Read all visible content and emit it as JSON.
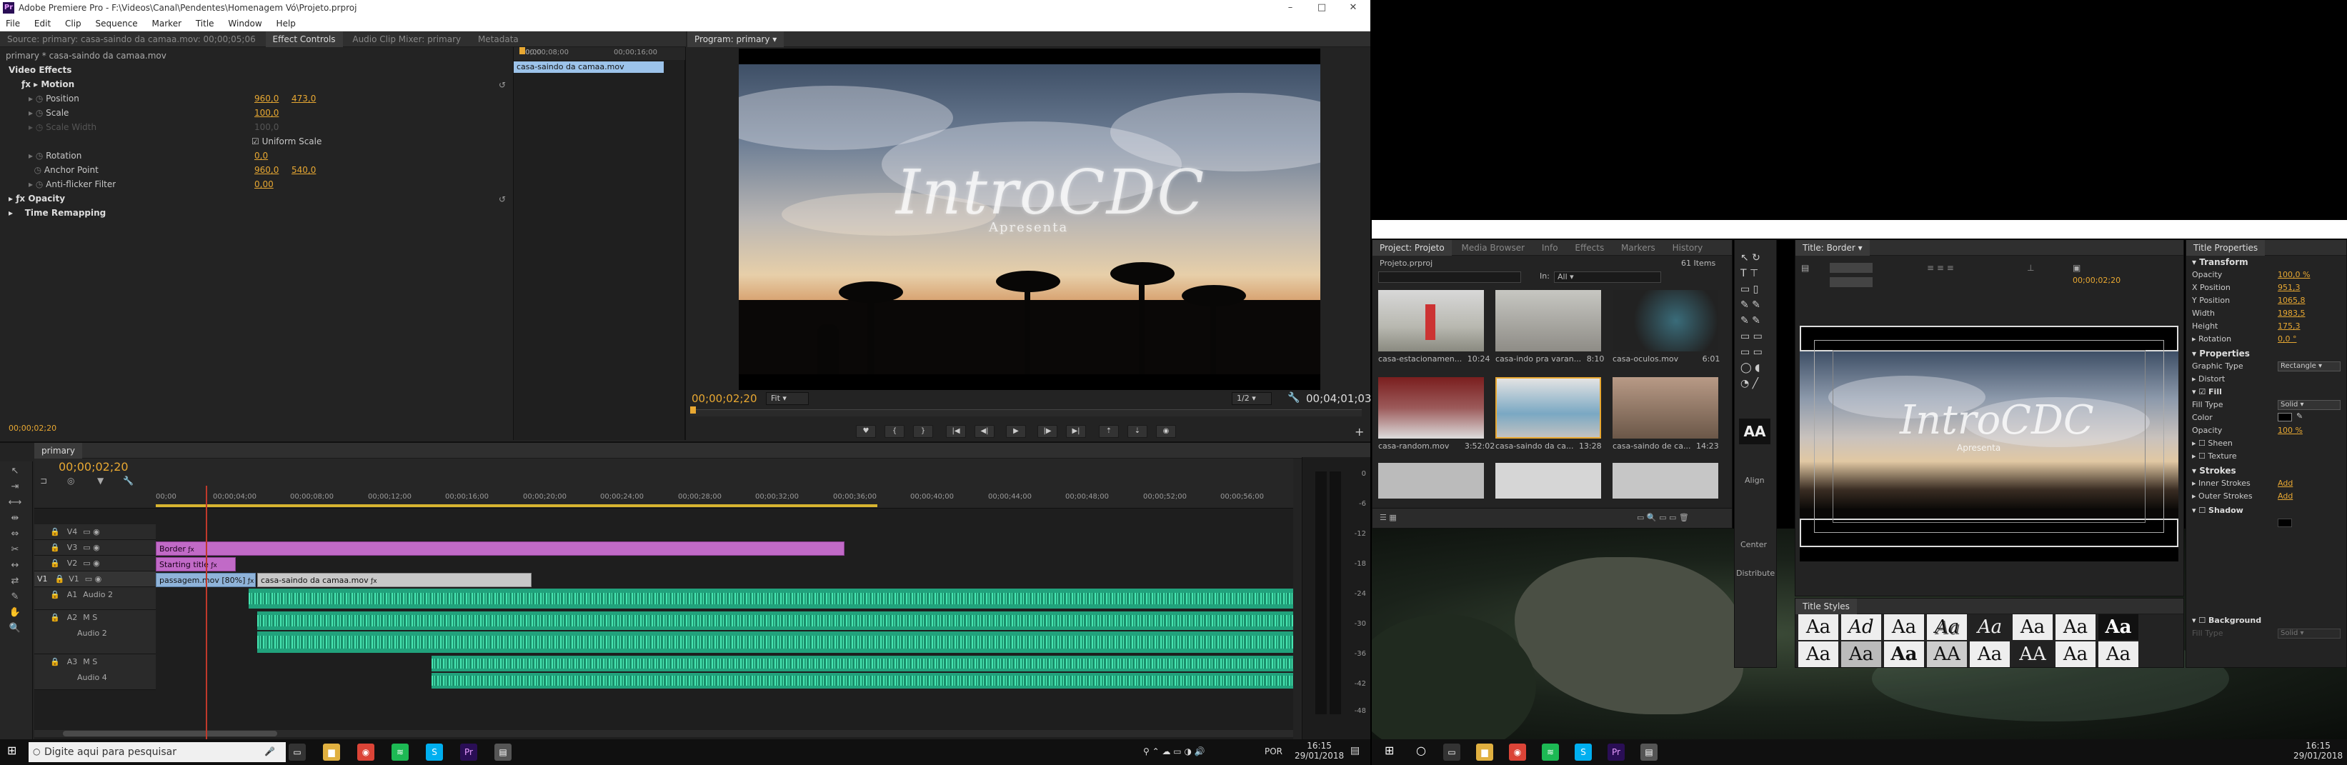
{
  "window": {
    "title": "Adobe Premiere Pro - F:\\Videos\\Canal\\Pendentes\\Homenagem Vó\\Projeto.prproj",
    "app_icon": "Pr"
  },
  "menu": [
    "File",
    "Edit",
    "Clip",
    "Sequence",
    "Marker",
    "Title",
    "Window",
    "Help"
  ],
  "source_panel": {
    "tabs": [
      "Source: primary: casa-saindo da camaa.mov: 00;00;05;06",
      "Effect Controls",
      "Audio Clip Mixer: primary",
      "Metadata"
    ],
    "clip_path": "primary * casa-saindo da camaa.mov",
    "mini_timeline": {
      "t0": "00;00",
      "t1": "00;00;08;00",
      "t2": "00;00;16;00",
      "clip_name": "casa-saindo da camaa.mov"
    },
    "video_effects_label": "Video Effects",
    "motion": "Motion",
    "params": [
      {
        "name": "Position",
        "v1": "960,0",
        "v2": "473,0"
      },
      {
        "name": "Scale",
        "v1": "100,0",
        "v2": ""
      },
      {
        "name": "Scale Width",
        "v1": "100,0",
        "v2": ""
      },
      {
        "name": "Rotation",
        "v1": "0,0",
        "v2": ""
      },
      {
        "name": "Anchor Point",
        "v1": "960,0",
        "v2": "540,0"
      },
      {
        "name": "Anti-flicker Filter",
        "v1": "0,00",
        "v2": ""
      }
    ],
    "uniform_scale": "Uniform Scale",
    "opacity": "Opacity",
    "time_remapping": "Time Remapping",
    "timecode": "00;00;02;20"
  },
  "program_panel": {
    "tab": "Program: primary",
    "current_tc": "00;00;02;20",
    "fit": "Fit",
    "resolution": "1/2",
    "duration_tc": "00;04;01;03",
    "overlay_title": "IntroCDC",
    "overlay_sub": "Apresenta"
  },
  "sequence": {
    "tab": "primary",
    "timecode": "00;00;02;20",
    "ruler": [
      "00;00",
      "00;00;04;00",
      "00;00;08;00",
      "00;00;12;00",
      "00;00;16;00",
      "00;00;20;00",
      "00;00;24;00",
      "00;00;28;00",
      "00;00;32;00",
      "00;00;36;00",
      "00;00;40;00",
      "00;00;44;00",
      "00;00;48;00",
      "00;00;52;00",
      "00;00;56;00"
    ],
    "tracks": [
      {
        "id": "V4",
        "name": ""
      },
      {
        "id": "V3",
        "name": ""
      },
      {
        "id": "V2",
        "name": ""
      },
      {
        "id": "V1",
        "name": "V1"
      },
      {
        "id": "A1",
        "name": "Audio 2"
      },
      {
        "id": "A2",
        "name": "Audio 2"
      },
      {
        "id": "A3",
        "name": "Audio 4"
      }
    ],
    "clips": {
      "border": "Border",
      "starting_title": "Starting title",
      "passagem": "passagem.mov [80%]",
      "casa": "casa-saindo da camaa.mov"
    },
    "meter_ticks": [
      "0",
      "-6",
      "-12",
      "-18",
      "-24",
      "-30",
      "-36",
      "-42",
      "-48"
    ]
  },
  "taskbar_left": {
    "search_placeholder": "Digite aqui para pesquisar",
    "lang": "POR",
    "time": "16:15",
    "date": "29/01/2018"
  },
  "project_panel": {
    "tabs": [
      "Project: Projeto",
      "Media Browser",
      "Info",
      "Effects",
      "Markers",
      "History"
    ],
    "file": "Projeto.prproj",
    "items_count": "61 Items",
    "in_label": "In:",
    "in_value": "All",
    "items": [
      {
        "name": "casa-estacionamen...",
        "dur": "10:24"
      },
      {
        "name": "casa-indo pra varan...",
        "dur": "8:10"
      },
      {
        "name": "casa-oculos.mov",
        "dur": "6:01"
      },
      {
        "name": "casa-random.mov",
        "dur": "3:52:02"
      },
      {
        "name": "casa-saindo da ca...",
        "dur": "13:28"
      },
      {
        "name": "casa-saindo de ca...",
        "dur": "14:23"
      }
    ]
  },
  "title_panel": {
    "tab": "Title: Border",
    "tc": "00;00;02;20",
    "align_label": "Align",
    "center_label": "Center",
    "distribute_label": "Distribute"
  },
  "title_props": {
    "tab": "Title Properties",
    "transform": "Transform",
    "rows": [
      {
        "name": "Opacity",
        "value": "100,0 %"
      },
      {
        "name": "X Position",
        "value": "951,3"
      },
      {
        "name": "Y Position",
        "value": "1065,8"
      },
      {
        "name": "Width",
        "value": "1983,5"
      },
      {
        "name": "Height",
        "value": "175,3"
      },
      {
        "name": "Rotation",
        "value": "0,0 °"
      }
    ],
    "properties": "Properties",
    "graphic_type": {
      "name": "Graphic Type",
      "value": "Rectangle"
    },
    "distort": "Distort",
    "fill": "Fill",
    "fill_type": {
      "name": "Fill Type",
      "value": "Solid"
    },
    "color": "Color",
    "opacity2": {
      "name": "Opacity",
      "value": "100 %"
    },
    "sheen": "Sheen",
    "texture": "Texture",
    "strokes": "Strokes",
    "inner": {
      "name": "Inner Strokes",
      "value": "Add"
    },
    "outer": {
      "name": "Outer Strokes",
      "value": "Add"
    },
    "shadow": "Shadow",
    "background": "Background",
    "bg_fill": {
      "name": "Fill Type",
      "value": "Solid"
    }
  },
  "title_styles": {
    "tab": "Title Styles",
    "samples": [
      "Aa",
      "Ad",
      "Aa",
      "Aa",
      "Aa",
      "Aa",
      "Aa",
      "Aa",
      "Aa",
      "Aa",
      "Aa",
      "AA",
      "Aa",
      "AA",
      "Aa",
      "Aa"
    ]
  },
  "taskbar_right": {
    "time": "16:15",
    "date": "29/01/2018"
  },
  "colors": {
    "accent": "#e8a832",
    "clip_pink": "#c16ac7",
    "clip_blue": "#8fb3d9",
    "audio": "#21a27c"
  }
}
